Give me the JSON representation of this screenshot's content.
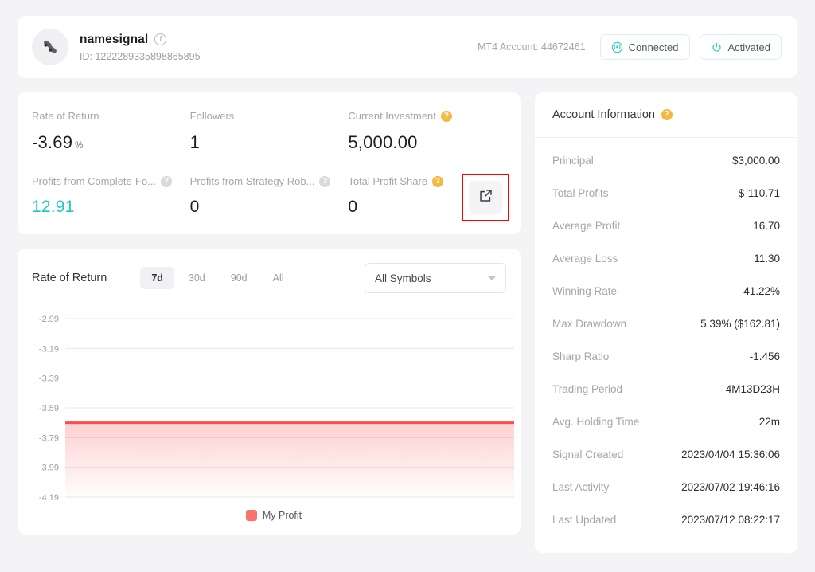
{
  "header": {
    "avatar_icon": "signal-logo-icon",
    "signal_name": "namesignal",
    "info_icon": "info-icon",
    "signal_id": "ID: 1222289335898865895",
    "mt4_account": "MT4 Account: 44672461",
    "connected_label": "Connected",
    "connected_icon": "broadcast-icon",
    "activated_label": "Activated",
    "activated_icon": "power-icon",
    "accent_teal": "#2cc9c0"
  },
  "stats": {
    "row1": [
      {
        "label": "Rate of Return",
        "value": "-3.69",
        "unit": "%",
        "help": "none",
        "color": "default"
      },
      {
        "label": "Followers",
        "value": "1",
        "unit": "",
        "help": "none",
        "color": "default"
      },
      {
        "label": "Current Investment",
        "value": "5,000.00",
        "unit": "",
        "help": "orange",
        "color": "default"
      }
    ],
    "row2": [
      {
        "label": "Profits from Complete-Fo...",
        "value": "12.91",
        "unit": "",
        "help": "gray",
        "color": "teal"
      },
      {
        "label": "Profits from Strategy Rob...",
        "value": "0",
        "unit": "",
        "help": "gray",
        "color": "default"
      },
      {
        "label": "Total Profit Share",
        "value": "0",
        "unit": "",
        "help": "orange",
        "color": "default"
      }
    ],
    "external_link_icon": "external-link-icon",
    "highlight_color": "#ff0000"
  },
  "chart": {
    "title": "Rate of Return",
    "ranges": [
      {
        "label": "7d",
        "active": true
      },
      {
        "label": "30d",
        "active": false
      },
      {
        "label": "90d",
        "active": false
      },
      {
        "label": "All",
        "active": false
      }
    ],
    "symbol_selected": "All Symbols",
    "dropdown_icon": "chevron-down-icon",
    "legend_label": "My Profit"
  },
  "chart_data": {
    "type": "line",
    "title": "Rate of Return",
    "xlabel": "",
    "ylabel": "",
    "series": [
      {
        "name": "My Profit",
        "color": "#fa4d4d",
        "fill": "rgba(250,77,77,0.18)",
        "x": [
          0,
          1,
          2,
          3,
          4,
          5,
          6
        ],
        "values": [
          -3.69,
          -3.69,
          -3.69,
          -3.69,
          -3.69,
          -3.69,
          -3.69
        ]
      }
    ],
    "yticks": [
      -2.99,
      -3.19,
      -3.39,
      -3.59,
      -3.79,
      -3.99,
      -4.19
    ],
    "ylim": [
      -4.19,
      -2.99
    ],
    "xticks": [],
    "grid": true,
    "legend_position": "bottom"
  },
  "account_info": {
    "title": "Account Information",
    "help_icon": "help-icon",
    "rows": [
      {
        "key": "Principal",
        "value": "$3,000.00"
      },
      {
        "key": "Total Profits",
        "value": "$-110.71"
      },
      {
        "key": "Average Profit",
        "value": "16.70"
      },
      {
        "key": "Average Loss",
        "value": "11.30"
      },
      {
        "key": "Winning Rate",
        "value": "41.22%"
      },
      {
        "key": "Max Drawdown",
        "value": "5.39% ($162.81)"
      },
      {
        "key": "Sharp Ratio",
        "value": "-1.456"
      },
      {
        "key": "Trading Period",
        "value": "4M13D23H"
      },
      {
        "key": "Avg. Holding Time",
        "value": "22m"
      },
      {
        "key": "Signal Created",
        "value": "2023/04/04 15:36:06"
      },
      {
        "key": "Last Activity",
        "value": "2023/07/02 19:46:16"
      },
      {
        "key": "Last Updated",
        "value": "2023/07/12 08:22:17"
      }
    ]
  }
}
